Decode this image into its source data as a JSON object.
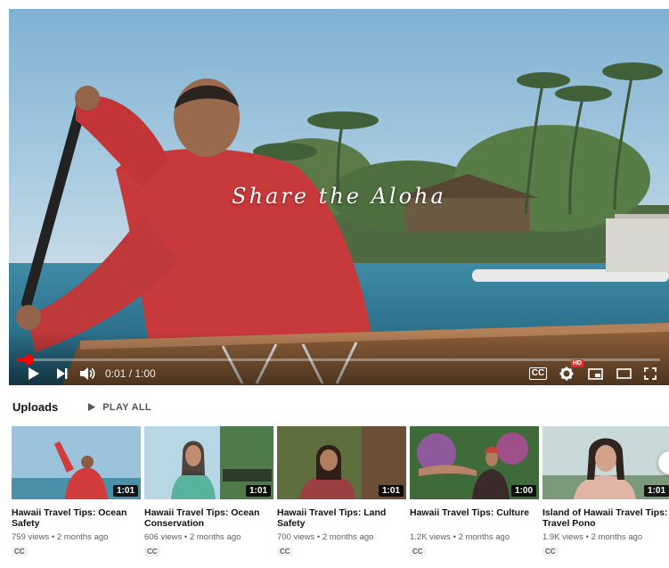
{
  "player": {
    "overlay_title": "Share the Aloha",
    "time_display": "0:01 / 1:00",
    "progress": 0.017,
    "captions_label": "CC",
    "hd_badge": "HD"
  },
  "shelf": {
    "title": "Uploads",
    "play_all_label": "PLAY ALL",
    "videos": [
      {
        "title": "Hawaii Travel Tips: Ocean Safety",
        "meta": "759 views • 2 months ago",
        "badge": "CC",
        "duration": "1:01"
      },
      {
        "title": "Hawaii Travel Tips: Ocean Conservation",
        "meta": "606 views • 2 months ago",
        "badge": "CC",
        "duration": "1:01"
      },
      {
        "title": "Hawaii Travel Tips: Land Safety",
        "meta": "700 views • 2 months ago",
        "badge": "CC",
        "duration": "1:01"
      },
      {
        "title": "Hawaii Travel Tips: Culture",
        "meta": "1.2K views • 2 months ago",
        "badge": "CC",
        "duration": "1:00"
      },
      {
        "title": "Island of Hawaii Travel Tips: Travel Pono",
        "meta": "1.9K views • 2 months ago",
        "badge": "CC",
        "duration": "1:01"
      }
    ]
  },
  "colors": {
    "progress": "#ff0000",
    "hd_badge": "#e52d27"
  }
}
